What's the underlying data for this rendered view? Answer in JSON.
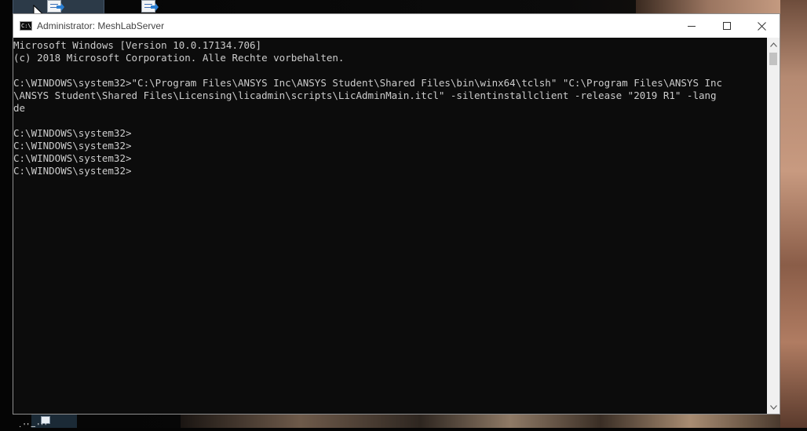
{
  "window": {
    "title": "Administrator: MeshLabServer",
    "icon_label": "C:\\",
    "icon": "console-icon",
    "controls": {
      "minimize_icon": "minimize-icon",
      "maximize_icon": "maximize-icon",
      "close_icon": "close-icon"
    }
  },
  "console": {
    "lines": [
      "Microsoft Windows [Version 10.0.17134.706]",
      "(c) 2018 Microsoft Corporation. Alle Rechte vorbehalten.",
      "",
      "C:\\WINDOWS\\system32>\"C:\\Program Files\\ANSYS Inc\\ANSYS Student\\Shared Files\\bin\\winx64\\tclsh\" \"C:\\Program Files\\ANSYS Inc",
      "\\ANSYS Student\\Shared Files\\Licensing\\licadmin\\scripts\\LicAdminMain.itcl\" -silentinstallclient -release \"2019 R1\" -lang",
      "de",
      "",
      "C:\\WINDOWS\\system32>",
      "C:\\WINDOWS\\system32>",
      "C:\\WINDOWS\\system32>",
      "C:\\WINDOWS\\system32>"
    ],
    "text_color": "#cccccc",
    "background_color": "#0c0c0c"
  },
  "desktop": {
    "icons": [
      "document-shortcut-icon",
      "document-shortcut-icon"
    ],
    "bottom_label": "· ' ' – ' ' '"
  }
}
